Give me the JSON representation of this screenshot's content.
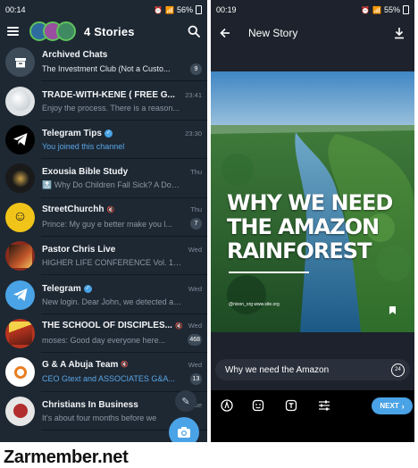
{
  "left": {
    "status": {
      "time": "00:14",
      "battery": "56%"
    },
    "header": {
      "title": "4 Stories"
    },
    "chats": [
      {
        "avatar_icon": "archive-icon",
        "name": "Archived Chats",
        "time": "",
        "message": "The Investment Club (Not a Custo...",
        "badge": "9",
        "avatar_color": "#3d4b59",
        "msg_style": "white",
        "verified": false,
        "muted": false
      },
      {
        "avatar_icon": "golf-ball-avatar",
        "name": "TRADE-WITH-KENE ( FREE G...",
        "time": "23:41",
        "message": "Enjoy the process.  There is a reason...",
        "badge": "",
        "avatar_color": "#dfe3e6",
        "msg_style": "",
        "verified": false,
        "muted": false
      },
      {
        "avatar_icon": "telegram-icon",
        "name": "Telegram Tips",
        "time": "23:30",
        "message": "You joined this channel",
        "badge": "",
        "avatar_color": "#000000",
        "msg_style": "blue",
        "verified": true,
        "muted": false
      },
      {
        "avatar_icon": "bible-avatar",
        "name": "Exousia Bible Study",
        "time": "Thu",
        "message": "🔝 Why Do Children Fall Sick? A Docu...",
        "badge": "",
        "avatar_color": "#1a1a1a",
        "msg_style": "",
        "verified": false,
        "muted": false
      },
      {
        "avatar_icon": "smiley-avatar",
        "name": "StreetChurchh",
        "time": "Thu",
        "message": "Prince: My guy e better make you l...",
        "badge": "7",
        "avatar_color": "#f0c419",
        "msg_style": "",
        "verified": false,
        "muted": true
      },
      {
        "avatar_icon": "poster-avatar",
        "name": "Pastor Chris Live",
        "time": "Wed",
        "message": "HIGHER LIFE CONFERENCE Vol. 10 Pa...",
        "badge": "",
        "avatar_color": "#8a2b1c",
        "msg_style": "",
        "verified": false,
        "muted": false
      },
      {
        "avatar_icon": "telegram-icon",
        "name": "Telegram",
        "time": "Wed",
        "message": "New login. Dear John, we detected a l...",
        "badge": "",
        "avatar_color": "#4aa3e6",
        "msg_style": "",
        "verified": true,
        "muted": false
      },
      {
        "avatar_icon": "discipleship-avatar",
        "name": "THE SCHOOL OF DISCIPLES...",
        "time": "Wed",
        "message": "moses: Good day everyone here...",
        "badge": "468",
        "avatar_color": "#b8341f",
        "msg_style": "",
        "verified": false,
        "muted": true
      },
      {
        "avatar_icon": "logo-avatar",
        "name": "G & A Abuja Team",
        "time": "Wed",
        "message": "CEO Gtext and ASSOCIATES G&A...",
        "badge": "13",
        "avatar_color": "#ffffff",
        "msg_style": "blue",
        "verified": false,
        "muted": true
      },
      {
        "avatar_icon": "business-avatar",
        "name": "Christians In Business",
        "time": "Tue",
        "message": "It's about four months before we",
        "badge": "",
        "avatar_color": "#e6e6e6",
        "msg_style": "",
        "verified": false,
        "muted": false
      }
    ]
  },
  "right": {
    "status": {
      "time": "00:19",
      "battery": "55%"
    },
    "header": {
      "title": "New Story"
    },
    "story": {
      "headline_1": "WHY WE  NEED",
      "headline_2": "THE AMAZON",
      "headline_3": "RAINFOREST",
      "small_print": "@nixon_org www.site.org"
    },
    "caption": "Why we need the Amazon",
    "timer": "24",
    "next_label": "NEXT"
  },
  "watermark": "Zarmember.net",
  "colors": {
    "accent": "#4aa3e6",
    "left_bg": "#1e2833",
    "right_bg": "#1d222c"
  }
}
